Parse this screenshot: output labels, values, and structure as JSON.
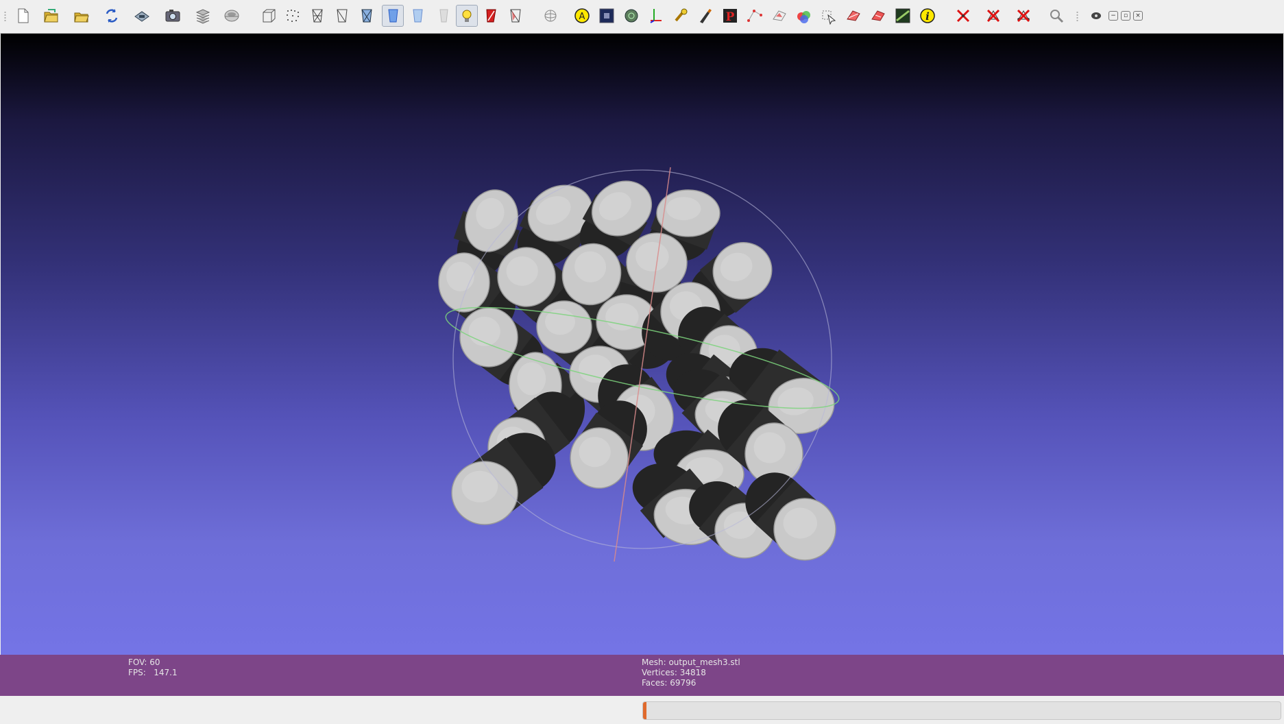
{
  "toolbar": {
    "buttons": [
      {
        "icon": "new-project-icon",
        "active": false
      },
      {
        "icon": "open-project-icon",
        "active": false
      },
      {
        "icon": "import-mesh-icon",
        "active": false
      },
      {
        "icon": "reload-icon",
        "active": false
      },
      {
        "icon": "export-mesh-icon",
        "active": false
      },
      {
        "icon": "snapshot-icon",
        "active": false
      },
      {
        "icon": "layers-icon",
        "active": false
      },
      {
        "icon": "raster-layers-icon",
        "active": false
      },
      {
        "icon": "bounding-box-icon",
        "active": false
      },
      {
        "icon": "points-icon",
        "active": false
      },
      {
        "icon": "wireframe-icon",
        "active": false
      },
      {
        "icon": "hidden-lines-icon",
        "active": false
      },
      {
        "icon": "flat-lines-icon",
        "active": false
      },
      {
        "icon": "flat-icon",
        "active": true
      },
      {
        "icon": "smooth-icon",
        "active": false
      },
      {
        "icon": "texture-icon",
        "active": false
      },
      {
        "icon": "lighting-icon",
        "active": true
      },
      {
        "icon": "back-face-icon",
        "active": false
      },
      {
        "icon": "selected-faces-icon",
        "active": false
      },
      {
        "icon": "trackball-icon",
        "active": false
      },
      {
        "icon": "annotation-icon",
        "active": false
      },
      {
        "icon": "camera-icon",
        "active": false
      },
      {
        "icon": "normals-icon",
        "active": false
      },
      {
        "icon": "axes-icon",
        "active": false
      },
      {
        "icon": "manipulator-icon",
        "active": false
      },
      {
        "icon": "paint-icon",
        "active": false
      },
      {
        "icon": "pick-points-icon",
        "active": false
      },
      {
        "icon": "select-vertices-icon",
        "active": false
      },
      {
        "icon": "select-faces-icon",
        "active": false
      },
      {
        "icon": "color-icon",
        "active": false
      },
      {
        "icon": "select-connected-icon",
        "active": false
      },
      {
        "icon": "select-region-icon",
        "active": false
      },
      {
        "icon": "select-region-alt-icon",
        "active": false
      },
      {
        "icon": "measure-icon",
        "active": false
      },
      {
        "icon": "info-icon",
        "active": false
      },
      {
        "icon": "delete-vertices-icon",
        "active": false
      },
      {
        "icon": "delete-faces-icon",
        "active": false
      },
      {
        "icon": "delete-faces-vertices-icon",
        "active": false
      },
      {
        "icon": "zoom-icon",
        "active": false
      },
      {
        "icon": "eye-icon",
        "active": false
      }
    ],
    "window_buttons": [
      "−",
      "▫",
      "×"
    ]
  },
  "viewport": {
    "background_top": "#000000",
    "background_bottom": "#7474e6",
    "trackball_colors": {
      "horizontal": "#7dd37d",
      "vertical": "#d98b8b",
      "sphere": "#b8b8d8"
    },
    "mesh_color": "#c9c9c9",
    "shadow_color": "#2d2d2d"
  },
  "info": {
    "fov": "FOV: 60",
    "fps": "FPS:   147.1",
    "mesh": "Mesh: output_mesh3.stl",
    "vertices": "Vertices: 34818",
    "faces": "Faces: 69796"
  },
  "colors": {
    "infobar": "#7d4588",
    "progress": "#e06a2c"
  },
  "progress": {
    "fraction": 0.005
  }
}
